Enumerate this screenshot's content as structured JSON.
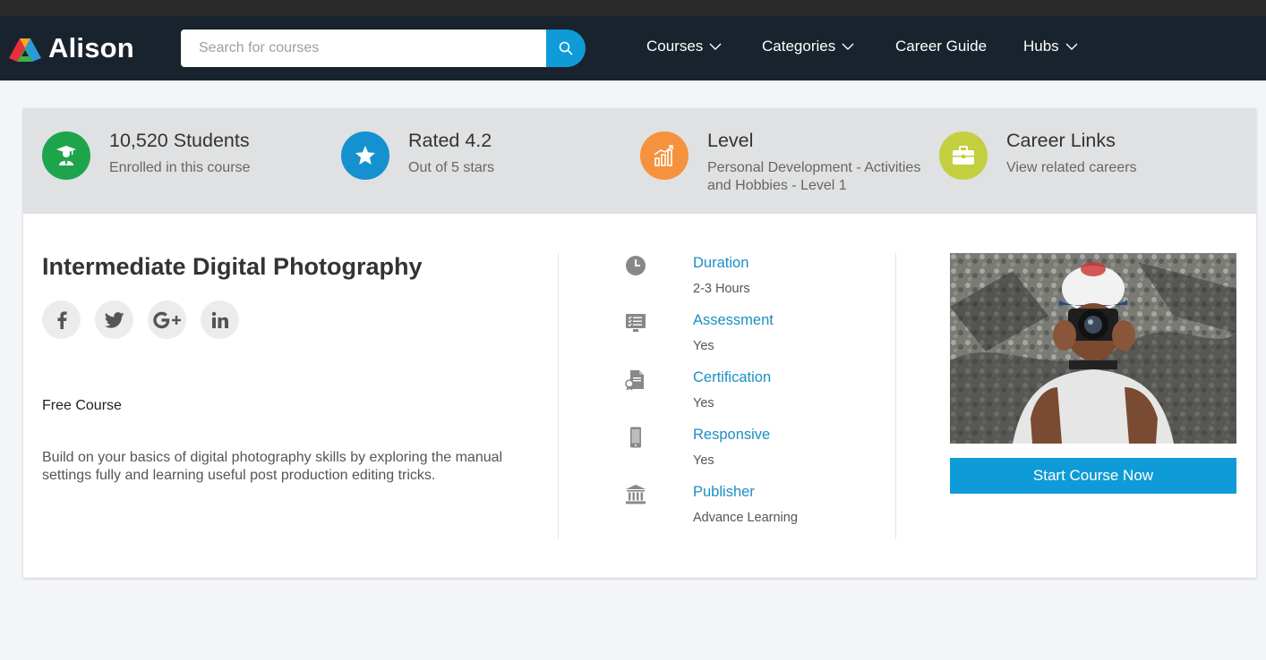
{
  "brand": {
    "name": "Alison"
  },
  "search": {
    "placeholder": "Search for courses",
    "value": ""
  },
  "nav": [
    {
      "label": "Courses",
      "dropdown": true
    },
    {
      "label": "Categories",
      "dropdown": true
    },
    {
      "label": "Career Guide",
      "dropdown": false
    },
    {
      "label": "Hubs",
      "dropdown": true
    }
  ],
  "stats": [
    {
      "title": "10,520 Students",
      "subtitle": "Enrolled in this course",
      "icon": "graduate-icon",
      "color": "#1ea54c"
    },
    {
      "title": "Rated 4.2",
      "subtitle": "Out of 5 stars",
      "icon": "star-icon",
      "color": "#1591cf"
    },
    {
      "title": "Level",
      "subtitle": "Personal Development - Activities and Hobbies - Level 1",
      "icon": "bar-chart-icon",
      "color": "#f5923e"
    },
    {
      "title": "Career Links",
      "subtitle": "View related careers",
      "icon": "briefcase-icon",
      "color": "#c3cf3e"
    }
  ],
  "course": {
    "title": "Intermediate Digital Photography",
    "price_label": "Free Course",
    "description": "Build on your basics of digital photography skills by exploring the manual settings fully and learning useful post production editing tricks."
  },
  "social": [
    "facebook-icon",
    "twitter-icon",
    "google-plus-icon",
    "linkedin-icon"
  ],
  "details": [
    {
      "label": "Duration",
      "value": "2-3 Hours",
      "icon": "clock-icon"
    },
    {
      "label": "Assessment",
      "value": "Yes",
      "icon": "checklist-monitor-icon"
    },
    {
      "label": "Certification",
      "value": "Yes",
      "icon": "certificate-icon"
    },
    {
      "label": "Responsive",
      "value": "Yes",
      "icon": "mobile-phone-icon"
    },
    {
      "label": "Publisher",
      "value": "Advance Learning",
      "icon": "bank-building-icon"
    }
  ],
  "cta": {
    "label": "Start Course Now"
  },
  "colors": {
    "nav_bg": "#19232d",
    "accent": "#0f9bd7",
    "link": "#1b8fc4",
    "stats_bg": "#e0e1e2"
  }
}
